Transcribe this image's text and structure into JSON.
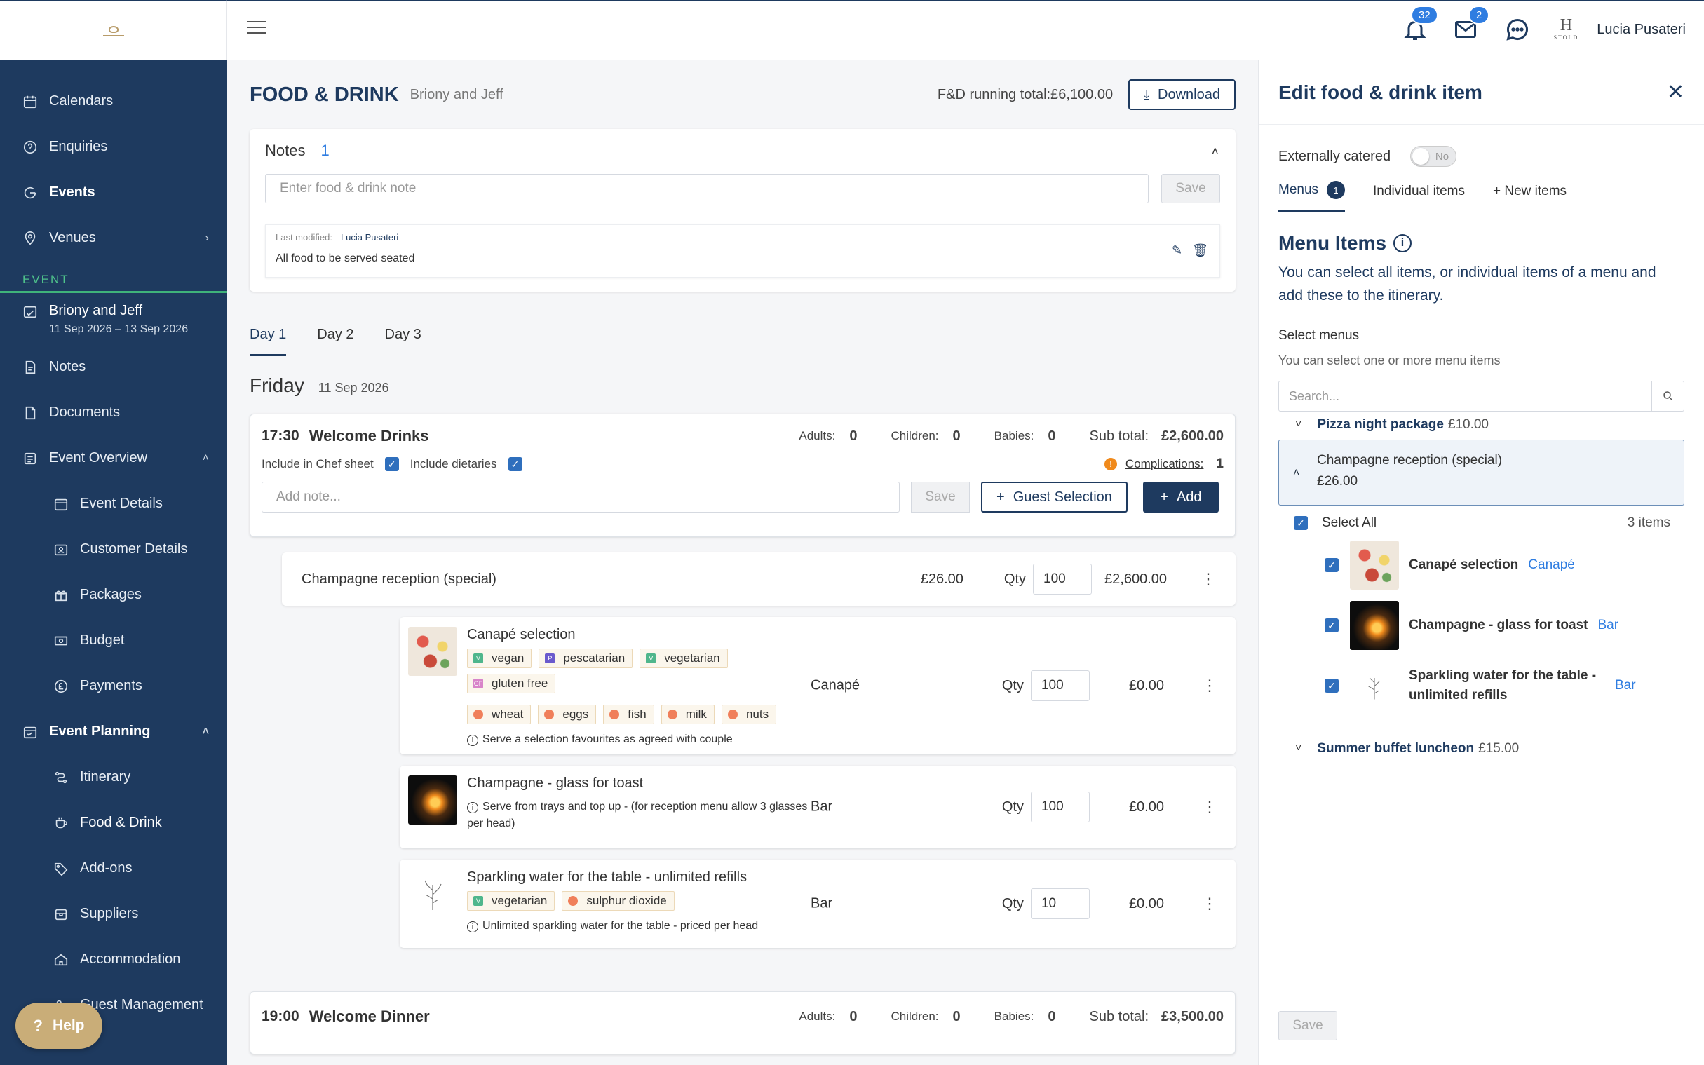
{
  "sidebar": {
    "items": [
      {
        "label": "Calendars",
        "icon": "calendar-icon"
      },
      {
        "label": "Enquiries",
        "icon": "question-icon"
      },
      {
        "label": "Events",
        "icon": "events-icon"
      },
      {
        "label": "Venues",
        "icon": "location-icon"
      }
    ],
    "event_section_label": "EVENT",
    "event_name": "Briony and Jeff",
    "event_dates": "11 Sep 2026 – 13 Sep 2026",
    "notes_label": "Notes",
    "documents_label": "Documents",
    "event_overview_label": "Event Overview",
    "overview_sub": [
      "Event Details",
      "Customer Details",
      "Packages",
      "Budget",
      "Payments"
    ],
    "event_planning_label": "Event Planning",
    "planning_sub": [
      "Itinerary",
      "Food & Drink",
      "Add-ons",
      "Suppliers",
      "Accommodation",
      "Guest Management"
    ],
    "help_label": "Help"
  },
  "topbar": {
    "notifications_count": "32",
    "mail_count": "2",
    "brand_mark": "H",
    "brand_word": "STOLD",
    "user_name": "Lucia Pusateri"
  },
  "page": {
    "title": "FOOD & DRINK",
    "subtitle": "Briony and Jeff",
    "running_total": "F&D running total:£6,100.00",
    "download_label": "Download"
  },
  "notes": {
    "title": "Notes",
    "count": "1",
    "placeholder": "Enter food & drink note",
    "save_label": "Save",
    "entry": {
      "meta_label": "Last modified:",
      "author": "Lucia Pusateri",
      "text": "All food to be served seated"
    }
  },
  "days": {
    "tabs": [
      "Day 1",
      "Day 2",
      "Day 3"
    ],
    "day_name": "Friday",
    "day_date": "11 Sep 2026"
  },
  "session1": {
    "time": "17:30",
    "name": "Welcome Drinks",
    "adults_label": "Adults:",
    "adults": "0",
    "children_label": "Children:",
    "children": "0",
    "babies_label": "Babies:",
    "babies": "0",
    "subtotal_label": "Sub total:",
    "subtotal": "£2,600.00",
    "chef_label": "Include in Chef sheet",
    "dietaries_label": "Include dietaries",
    "complications_label": "Complications:",
    "complications_count": "1",
    "note_placeholder": "Add note...",
    "save_label": "Save",
    "guest_selection_label": "Guest Selection",
    "add_label": "Add",
    "menu": {
      "name": "Champagne reception (special)",
      "price": "£26.00",
      "qty_label": "Qty",
      "qty": "100",
      "total": "£2,600.00"
    },
    "items": [
      {
        "title": "Canapé selection",
        "tags": [
          "vegan",
          "pescatarian",
          "vegetarian",
          "gluten free",
          "wheat",
          "eggs",
          "fish",
          "milk",
          "nuts"
        ],
        "note": "Serve a selection favourites as agreed with couple",
        "category": "Canapé",
        "qty": "100",
        "total": "£0.00"
      },
      {
        "title": "Champagne - glass for toast",
        "note": "Serve from trays and top up - (for reception menu allow 3 glasses per head)",
        "category": "Bar",
        "qty": "100",
        "total": "£0.00"
      },
      {
        "title": "Sparkling water for the table - unlimited refills",
        "tags": [
          "vegetarian",
          "sulphur dioxide"
        ],
        "note": "Unlimited sparkling water for the table - priced per head",
        "category": "Bar",
        "qty": "10",
        "total": "£0.00"
      }
    ]
  },
  "session2": {
    "time": "19:00",
    "name": "Welcome Dinner",
    "adults": "0",
    "children": "0",
    "babies": "0",
    "subtotal": "£3,500.00"
  },
  "panel": {
    "title": "Edit food & drink item",
    "externally_catered_label": "Externally catered",
    "toggle_label": "No",
    "tabs": {
      "menus": "Menus",
      "menus_count": "1",
      "individual": "Individual items",
      "new_items": "+ New items"
    },
    "menu_items_title": "Menu Items",
    "menu_items_desc": "You can select all items, or individual items of a menu and add these to the itinerary.",
    "select_menus_label": "Select menus",
    "select_hint": "You can select one or more menu items",
    "search_placeholder": "Search...",
    "menus": [
      {
        "name": "Pizza night package",
        "price": "£10.00"
      },
      {
        "name": "Champagne reception (special)",
        "price": "£26.00"
      },
      {
        "name": "Summer buffet luncheon",
        "price": "£15.00"
      }
    ],
    "select_all_label": "Select All",
    "items_count": "3 items",
    "items": [
      {
        "name": "Canapé selection",
        "category": "Canapé"
      },
      {
        "name": "Champagne - glass for toast",
        "category": "Bar"
      },
      {
        "name": "Sparkling water for the table - unlimited refills",
        "category": "Bar"
      }
    ],
    "save_label": "Save"
  },
  "colors": {
    "sidebar_bg": "#1e3a5f",
    "accent_green": "#3fb37a",
    "primary": "#1e3a5f",
    "link_blue": "#2f7de1",
    "warning": "#f08a1c",
    "help_gold": "#c9ad78"
  }
}
